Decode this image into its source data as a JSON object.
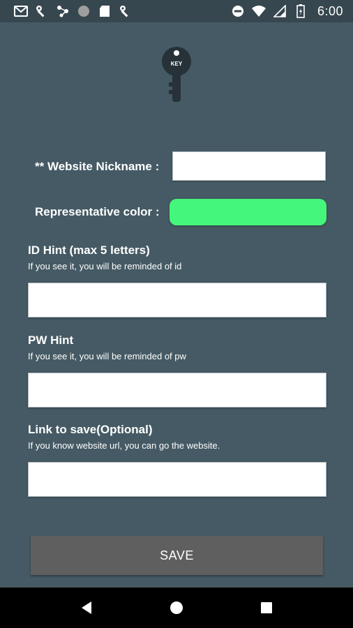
{
  "status_bar": {
    "time": "6:00",
    "left_icons": [
      "gmail-icon",
      "wrench-icon",
      "share-icon",
      "circle-icon",
      "sd-card-icon",
      "wrench-icon"
    ],
    "right_icons": [
      "do-not-disturb-icon",
      "wifi-icon",
      "signal-icon",
      "battery-icon"
    ]
  },
  "logo": {
    "text": "KEY"
  },
  "form": {
    "nickname_label": "** Website Nickname :",
    "nickname_value": "",
    "color_label": "Representative color :",
    "color_value": "#44f67a",
    "id_hint": {
      "title": "ID Hint (max 5 letters)",
      "hint": "If you see it, you will be reminded of id",
      "value": ""
    },
    "pw_hint": {
      "title": "PW Hint",
      "hint": "If you see it, you will be reminded of pw",
      "value": ""
    },
    "link": {
      "title": "Link to save(Optional)",
      "hint": "If you know website url, you can go the website.",
      "value": ""
    },
    "save_label": "SAVE"
  },
  "nav_bar": {
    "buttons": [
      "back-icon",
      "home-icon",
      "recents-icon"
    ]
  },
  "colors": {
    "background": "#455a64",
    "status_bar": "#37474f",
    "save_button": "#5f5f5f",
    "color_swatch": "#44f67a"
  }
}
